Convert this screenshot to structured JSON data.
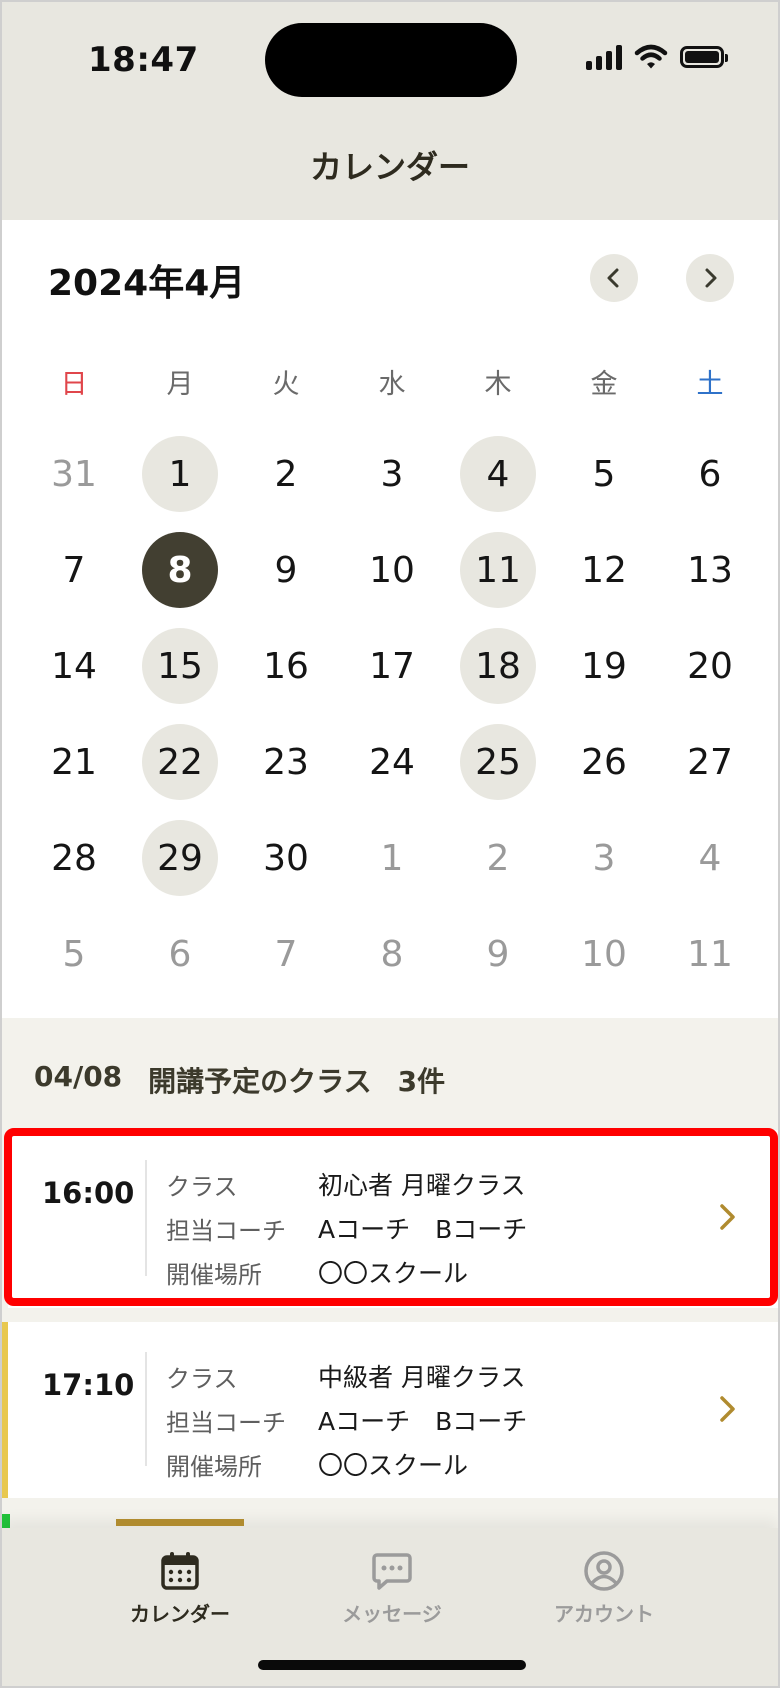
{
  "status_bar": {
    "time": "18:47"
  },
  "header": {
    "title": "カレンダー"
  },
  "calendar": {
    "month_label": "2024年4月",
    "weekdays": [
      "日",
      "月",
      "火",
      "水",
      "木",
      "金",
      "土"
    ],
    "weeks": [
      [
        {
          "d": "31",
          "muted": true
        },
        {
          "d": "1",
          "has": true
        },
        {
          "d": "2"
        },
        {
          "d": "3"
        },
        {
          "d": "4",
          "has": true
        },
        {
          "d": "5"
        },
        {
          "d": "6"
        }
      ],
      [
        {
          "d": "7"
        },
        {
          "d": "8",
          "selected": true
        },
        {
          "d": "9"
        },
        {
          "d": "10"
        },
        {
          "d": "11",
          "has": true
        },
        {
          "d": "12"
        },
        {
          "d": "13"
        }
      ],
      [
        {
          "d": "14"
        },
        {
          "d": "15",
          "has": true
        },
        {
          "d": "16"
        },
        {
          "d": "17"
        },
        {
          "d": "18",
          "has": true
        },
        {
          "d": "19"
        },
        {
          "d": "20"
        }
      ],
      [
        {
          "d": "21"
        },
        {
          "d": "22",
          "has": true
        },
        {
          "d": "23"
        },
        {
          "d": "24"
        },
        {
          "d": "25",
          "has": true
        },
        {
          "d": "26"
        },
        {
          "d": "27"
        }
      ],
      [
        {
          "d": "28"
        },
        {
          "d": "29",
          "has": true
        },
        {
          "d": "30"
        },
        {
          "d": "1",
          "muted": true
        },
        {
          "d": "2",
          "muted": true
        },
        {
          "d": "3",
          "muted": true
        },
        {
          "d": "4",
          "muted": true
        }
      ],
      [
        {
          "d": "5",
          "muted": true
        },
        {
          "d": "6",
          "muted": true
        },
        {
          "d": "7",
          "muted": true
        },
        {
          "d": "8",
          "muted": true
        },
        {
          "d": "9",
          "muted": true
        },
        {
          "d": "10",
          "muted": true
        },
        {
          "d": "11",
          "muted": true
        }
      ]
    ]
  },
  "summary": {
    "date": "04/08",
    "heading": "開講予定のクラス",
    "count": "3件"
  },
  "classes": [
    {
      "time": "16:00",
      "class_label": "クラス",
      "class_value": "初心者 月曜クラス",
      "coach_label": "担当コーチ",
      "coach_value": "Aコーチ　Bコーチ",
      "place_label": "開催場所",
      "place_value": "〇〇スクール",
      "accent": "#ffffff"
    },
    {
      "time": "17:10",
      "class_label": "クラス",
      "class_value": "中級者 月曜クラス",
      "coach_label": "担当コーチ",
      "coach_value": "Aコーチ　Bコーチ",
      "place_label": "開催場所",
      "place_value": "〇〇スクール",
      "accent": "#e8c84f"
    }
  ],
  "tabbar": {
    "calendar": "カレンダー",
    "message": "メッセージ",
    "account": "アカウント"
  },
  "colors": {
    "header_bg": "#e8e7e0",
    "selected_day": "#423f31",
    "tab_indicator": "#b08b2f",
    "chevron": "#b08b2f",
    "highlight": "#ff0000"
  }
}
